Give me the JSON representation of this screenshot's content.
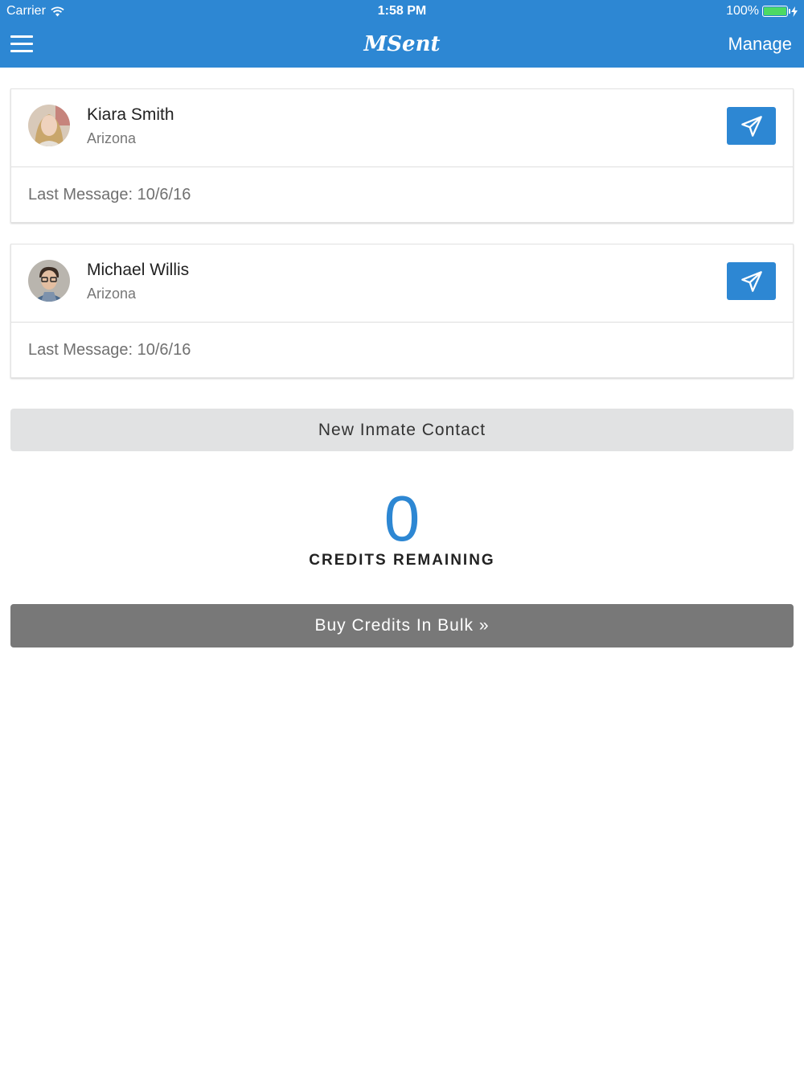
{
  "status_bar": {
    "carrier": "Carrier",
    "time": "1:58 PM",
    "battery": "100%",
    "battery_level": 1.0
  },
  "nav": {
    "title": "MSent",
    "manage_label": "Manage",
    "menu_icon": "hamburger-menu-icon"
  },
  "contacts": [
    {
      "name": "Kiara Smith",
      "state": "Arizona",
      "last_message": "Last Message: 10/6/16",
      "action_icon": "paper-plane-icon"
    },
    {
      "name": "Michael Willis",
      "state": "Arizona",
      "last_message": "Last Message: 10/6/16",
      "action_icon": "paper-plane-icon"
    }
  ],
  "new_contact_label": "New Inmate Contact",
  "credits": {
    "count": "0",
    "label": "CREDITS REMAINING"
  },
  "buy_label": "Buy Credits In Bulk »",
  "colors": {
    "brand": "#2d87d3",
    "secondary_button": "#e1e2e3",
    "buy_button": "#787878"
  }
}
